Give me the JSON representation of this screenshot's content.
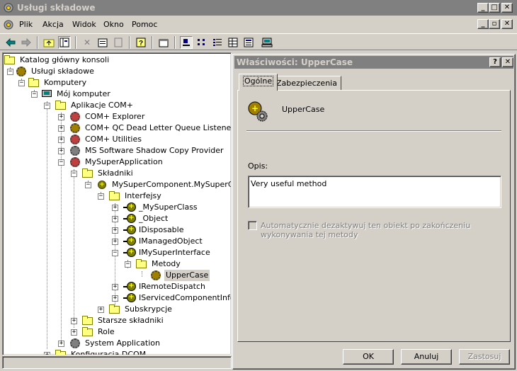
{
  "window": {
    "title": "Usługi składowe",
    "icon": "component-services-icon"
  },
  "menu": [
    {
      "label": "Plik"
    },
    {
      "label": "Akcja"
    },
    {
      "label": "Widok"
    },
    {
      "label": "Okno"
    },
    {
      "label": "Pomoc"
    }
  ],
  "toolbar": {
    "buttons": [
      "back-arrow-icon",
      "forward-arrow-icon",
      "up-folder-icon",
      "show-hide-tree-icon",
      "delete-icon",
      "properties-icon",
      "refresh-icon",
      "help-icon",
      "new-window-icon",
      "large-icons-icon",
      "small-icons-icon",
      "list-view-icon",
      "detail-view-icon",
      "status-view-icon",
      "computer-icon"
    ]
  },
  "tree": {
    "nodes": [
      {
        "label": "Katalog główny konsoli"
      },
      {
        "label": "Usługi składowe"
      },
      {
        "label": "Komputery"
      },
      {
        "label": "Mój komputer"
      },
      {
        "label": "Aplikacje COM+"
      },
      {
        "label": "COM+ Explorer"
      },
      {
        "label": "COM+ QC Dead Letter Queue Listener"
      },
      {
        "label": "COM+ Utilities"
      },
      {
        "label": "MS Software Shadow Copy Provider"
      },
      {
        "label": "MySuperApplication"
      },
      {
        "label": "Składniki"
      },
      {
        "label": "MySuperComponent.MySuperClass"
      },
      {
        "label": "Interfejsy"
      },
      {
        "label": "_MySuperClass"
      },
      {
        "label": "_Object"
      },
      {
        "label": "IDisposable"
      },
      {
        "label": "IManagedObject"
      },
      {
        "label": "IMySuperInterface"
      },
      {
        "label": "Metody"
      },
      {
        "label": "UpperCase"
      },
      {
        "label": "IRemoteDispatch"
      },
      {
        "label": "IServicedComponentInfo"
      },
      {
        "label": "Subskrypcje"
      },
      {
        "label": "Starsze składniki"
      },
      {
        "label": "Role"
      },
      {
        "label": "System Application"
      },
      {
        "label": "Konfiguracja DCOM"
      }
    ],
    "selected": "UpperCase"
  },
  "dialog": {
    "title": "Właściwości: UpperCase",
    "help_label": "?",
    "close_label": "✕",
    "tabs": [
      {
        "label": "Ogólne"
      },
      {
        "label": "Zabezpieczenia"
      }
    ],
    "object_name": "UpperCase",
    "description_label": "Opis:",
    "description_value": "Very useful method",
    "auto_deactivate_label": "Automatycznie dezaktywuj ten obiekt po zakończeniu wykonywania tej metody",
    "auto_deactivate_checked": false,
    "ok_label": "OK",
    "cancel_label": "Anuluj",
    "apply_label": "Zastosuj"
  }
}
